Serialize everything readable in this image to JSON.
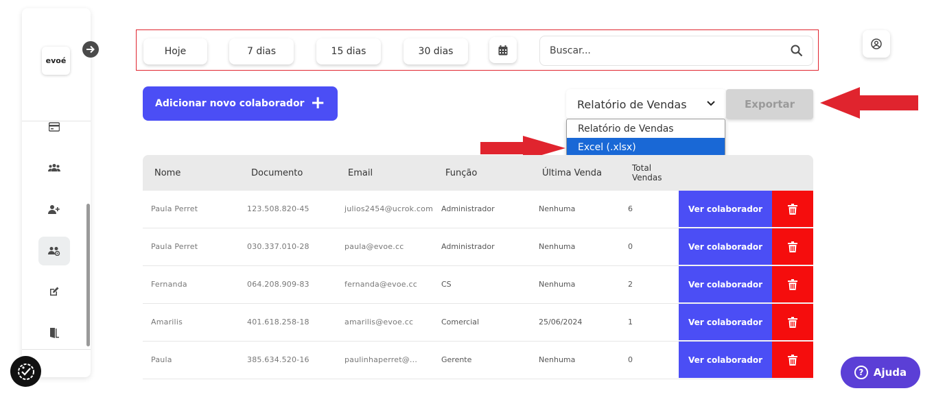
{
  "sidebar": {
    "logo": "evoé",
    "items": [
      {
        "icon": "credit-card-icon"
      },
      {
        "icon": "users-icon"
      },
      {
        "icon": "add-user-icon"
      },
      {
        "icon": "team-icon",
        "active": true
      },
      {
        "icon": "edit-icon"
      },
      {
        "icon": "door-exit-icon"
      }
    ]
  },
  "filters": {
    "today": "Hoje",
    "d7": "7 dias",
    "d15": "15 dias",
    "d30": "30 dias",
    "search_placeholder": "Buscar..."
  },
  "actions": {
    "add_label": "Adicionar novo colaborador",
    "report_selected": "Relatório de Vendas",
    "export_label": "Exportar",
    "report_options": [
      "Relatório de Vendas",
      "Excel (.xlsx)"
    ],
    "highlighted_option": "Excel (.xlsx)"
  },
  "table": {
    "headers": [
      "Nome",
      "Documento",
      "Email",
      "Função",
      "Última Venda",
      "Total Vendas"
    ],
    "rows": [
      {
        "name": "Paula Perret",
        "doc": "123.508.820-45",
        "email": "julios2454@ucrok.com",
        "role": "Administrador",
        "last": "Nenhuma",
        "total": "6"
      },
      {
        "name": "Paula Perret",
        "doc": "030.337.010-28",
        "email": "paula@evoe.cc",
        "role": "Administrador",
        "last": "Nenhuma",
        "total": "0"
      },
      {
        "name": "Fernanda",
        "doc": "064.208.909-83",
        "email": "fernanda@evoe.cc",
        "role": "CS",
        "last": "Nenhuma",
        "total": "2"
      },
      {
        "name": "Amarilis",
        "doc": "401.618.258-18",
        "email": "amarilis@evoe.cc",
        "role": "Comercial",
        "last": "25/06/2024",
        "total": "1"
      },
      {
        "name": "Paula",
        "doc": "385.634.520-16",
        "email": "paulinhaperret@...",
        "role": "Gerente",
        "last": "Nenhuma",
        "total": "0"
      }
    ],
    "view_label": "Ver colaborador"
  },
  "help": {
    "label": "Ajuda"
  },
  "colors": {
    "primary": "#4b4ef5",
    "danger": "#f50d0d",
    "highlight": "#1968d6",
    "annotation": "#e0242e"
  }
}
